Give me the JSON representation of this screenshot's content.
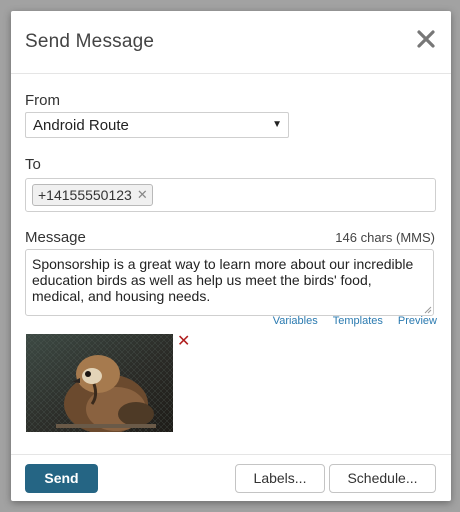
{
  "dialog": {
    "title": "Send Message",
    "close_label": "✕"
  },
  "from": {
    "label": "From",
    "selected": "Android Route"
  },
  "to": {
    "label": "To",
    "recipients": [
      "+14155550123"
    ]
  },
  "message": {
    "label": "Message",
    "char_count": "146 chars (MMS)",
    "text": "Sponsorship is a great way to learn more about our incredible education birds as well as help us meet the birds' food, medical, and housing needs.",
    "links": [
      "Variables",
      "Templates",
      "Preview"
    ]
  },
  "attachment": {
    "icon": "bird-photo-thumbnail",
    "remove_icon": "remove-x-icon",
    "remove_color": "#b01e1e"
  },
  "footer": {
    "send_label": "Send",
    "labels_label": "Labels...",
    "schedule_label": "Schedule..."
  },
  "colors": {
    "primary": "#256584",
    "link": "#2a7ab0"
  }
}
